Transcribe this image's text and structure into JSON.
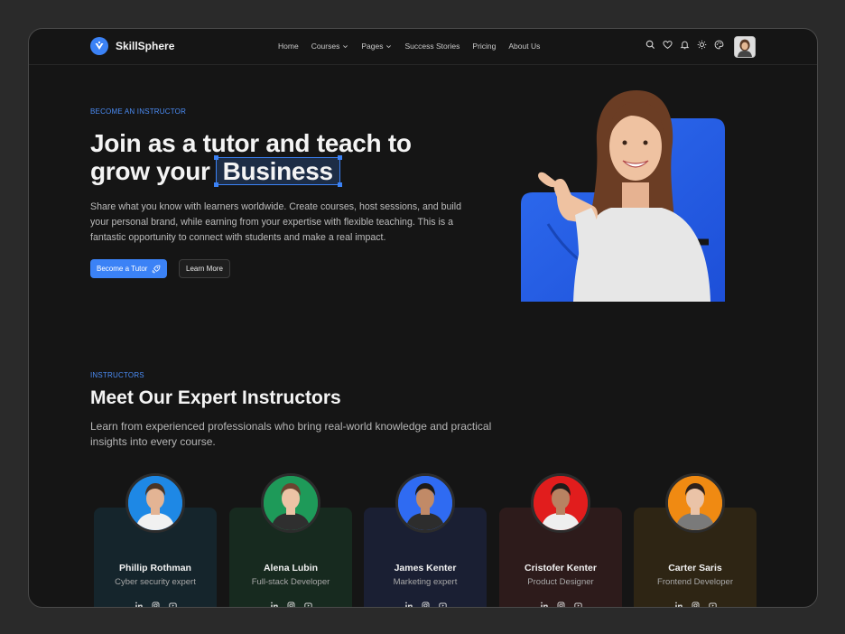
{
  "header": {
    "brand": "SkillSphere",
    "nav": [
      {
        "label": "Home"
      },
      {
        "label": "Courses",
        "dropdown": true
      },
      {
        "label": "Pages",
        "dropdown": true
      },
      {
        "label": "Success Stories"
      },
      {
        "label": "Pricing"
      },
      {
        "label": "About Us"
      }
    ],
    "tools": [
      "search-icon",
      "heart-icon",
      "bell-icon",
      "sun-icon",
      "palette-icon"
    ]
  },
  "hero": {
    "eyebrow": "BECOME AN INSTRUCTOR",
    "title_line1": "Join as a tutor and teach to",
    "title_line2": "grow your",
    "title_highlight": "Business",
    "description": "Share what you know with learners worldwide. Create courses, host sessions, and build your personal brand, while earning from your expertise with flexible teaching. This is a fantastic opportunity to connect with students and make a real impact.",
    "primary_button": "Become a Tutor",
    "secondary_button": "Learn More"
  },
  "instructors": {
    "eyebrow": "INSTRUCTORS",
    "title": "Meet Our Expert Instructors",
    "description": "Learn from experienced professionals who bring real-world knowledge and practical insights into every course.",
    "cards": [
      {
        "name": "Phillip Rothman",
        "role": "Cyber security expert",
        "card_color": "#15252c",
        "avatar_bg": "#1e88e5",
        "skin": "#e3b494",
        "hair": "#4a3526",
        "shirt": "#f1f1f1"
      },
      {
        "name": "Alena Lubin",
        "role": "Full-stack Developer",
        "card_color": "#172a1f",
        "avatar_bg": "#1e9a59",
        "skin": "#ecc3a5",
        "hair": "#6b4430",
        "shirt": "#2f2f2f"
      },
      {
        "name": "James Kenter",
        "role": "Marketing expert",
        "card_color": "#1a1f33",
        "avatar_bg": "#2f6bf2",
        "skin": "#c18a67",
        "hair": "#1d1b1a",
        "shirt": "#2d2d2d"
      },
      {
        "name": "Cristofer Kenter",
        "role": "Product Designer",
        "card_color": "#2d1b1b",
        "avatar_bg": "#e11d1d",
        "skin": "#b88262",
        "hair": "#1f1b19",
        "shirt": "#eeeeee"
      },
      {
        "name": "Carter Saris",
        "role": "Frontend Developer",
        "card_color": "#2e2514",
        "avatar_bg": "#f08a12",
        "skin": "#eac3a7",
        "hair": "#2e211b",
        "shirt": "#7a7a7a"
      }
    ],
    "social_icons": [
      "linkedin-icon",
      "instagram-icon",
      "youtube-icon"
    ]
  },
  "colors": {
    "accent": "#3b82f6",
    "background": "#151515",
    "outer_background": "#2a2a2a"
  }
}
